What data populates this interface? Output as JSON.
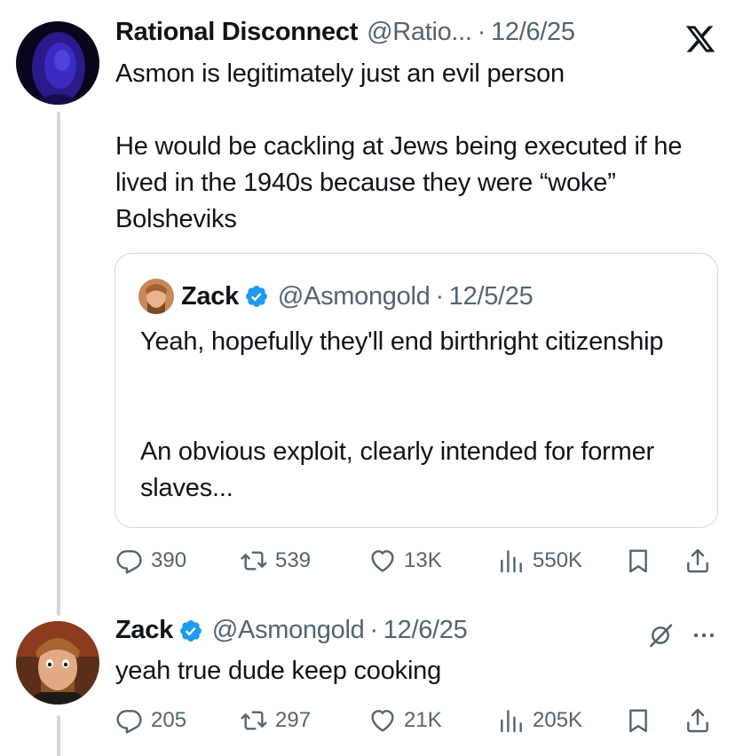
{
  "main_tweet": {
    "author_name": "Rational Disconnect",
    "handle": "@Ratio...",
    "separator": "·",
    "date": "12/6/25",
    "text_line1": "Asmon is legitimately just an evil person",
    "text_para2": "He would be cackling at Jews being executed if he lived in the 1940s because they were “woke” Bolsheviks",
    "stats": {
      "replies": "390",
      "reposts": "539",
      "likes": "13K",
      "views": "550K"
    }
  },
  "quoted_tweet": {
    "author_name": "Zack",
    "handle": "@Asmongold",
    "separator": "·",
    "date": "12/5/25",
    "text_para1": "Yeah, hopefully they'll end birthright citizenship",
    "text_para2": "An obvious exploit, clearly intended for former slaves..."
  },
  "reply_tweet": {
    "author_name": "Zack",
    "handle": "@Asmongold",
    "separator": "·",
    "date": "12/6/25",
    "text": "yeah true dude keep cooking",
    "stats": {
      "replies": "205",
      "reposts": "297",
      "likes": "21K",
      "views": "205K"
    }
  },
  "icons": {
    "platform_logo": "x-logo-icon",
    "verified": "verified-badge-icon",
    "reply": "reply-icon",
    "repost": "repost-icon",
    "like": "like-icon",
    "views": "views-icon",
    "bookmark": "bookmark-icon",
    "share": "share-icon",
    "grok": "grok-icon",
    "more": "more-icon"
  },
  "colors": {
    "text_primary": "#0f1419",
    "text_secondary": "#536471",
    "verified_blue": "#1d9bf0",
    "border": "#cfd9de"
  }
}
